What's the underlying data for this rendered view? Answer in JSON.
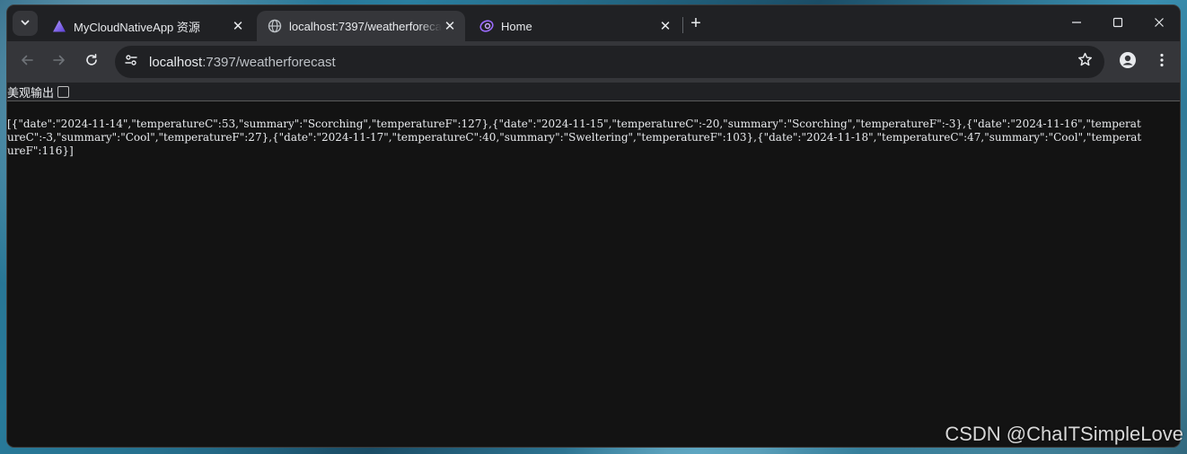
{
  "tabs": [
    {
      "title": "MyCloudNativeApp 资源",
      "icon": "triangle-app-icon",
      "active": false
    },
    {
      "title": "localhost:7397/weatherforecast",
      "icon": "globe-icon",
      "active": true
    },
    {
      "title": "Home",
      "icon": "blazor-swirl-icon",
      "active": false
    }
  ],
  "toolbar": {
    "url_host": "localhost",
    "url_path": ":7397/weatherforecast"
  },
  "page": {
    "pretty_print_label": "美观输出",
    "pretty_print_checked": false,
    "json_text": "[{\"date\":\"2024-11-14\",\"temperatureC\":53,\"summary\":\"Scorching\",\"temperatureF\":127},{\"date\":\"2024-11-15\",\"temperatureC\":-20,\"summary\":\"Scorching\",\"temperatureF\":-3},{\"date\":\"2024-11-16\",\"temperatureC\":-3,\"summary\":\"Cool\",\"temperatureF\":27},{\"date\":\"2024-11-17\",\"temperatureC\":40,\"summary\":\"Sweltering\",\"temperatureF\":103},{\"date\":\"2024-11-18\",\"temperatureC\":47,\"summary\":\"Cool\",\"temperatureF\":116}]"
  },
  "watermark": "CSDN @ChaITSimpleLove",
  "colors": {
    "tab_active": "#35363a",
    "frame": "#202124",
    "page_bg": "#131313",
    "text": "#e8eaed"
  }
}
